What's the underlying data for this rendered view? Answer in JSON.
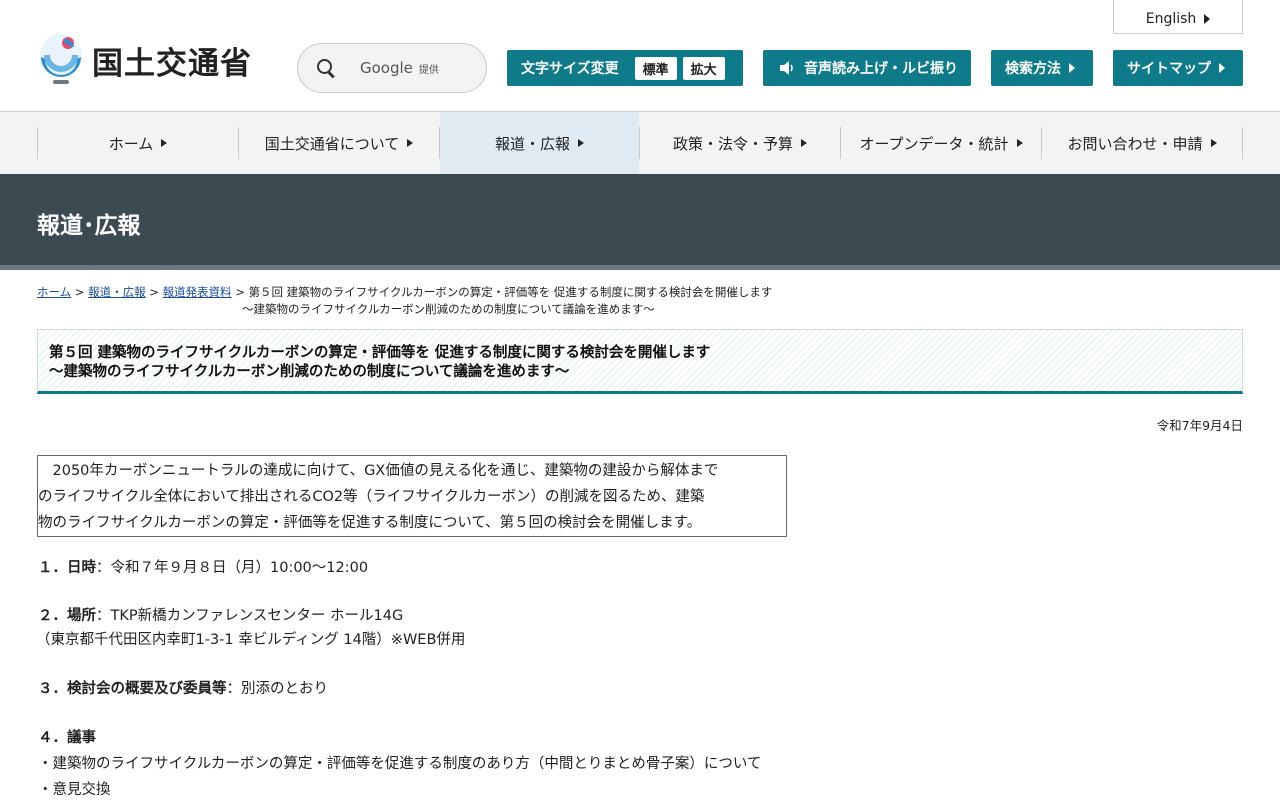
{
  "header": {
    "logo_text": "国土交通省",
    "search": {
      "label": "Google",
      "sub": "提供"
    },
    "english_label": "English",
    "font_size": {
      "label": "文字サイズ変更",
      "standard": "標準",
      "large": "拡大"
    },
    "voice_label": "音声読み上げ・ルビ振り",
    "search_method_label": "検索方法",
    "sitemap_label": "サイトマップ"
  },
  "nav": {
    "items": [
      {
        "label": "ホーム"
      },
      {
        "label": "国土交通省について"
      },
      {
        "label": "報道・広報"
      },
      {
        "label": "政策・法令・予算"
      },
      {
        "label": "オープンデータ・統計"
      },
      {
        "label": "お問い合わせ・申請"
      }
    ]
  },
  "banner": {
    "title": "報道･広報"
  },
  "breadcrumb": {
    "home": "ホーム",
    "press": "報道・広報",
    "releases": "報道発表資料",
    "sep": " > ",
    "current_line1": "第５回 建築物のライフサイクルカーボンの算定・評価等を 促進する制度に関する検討会を開催します",
    "current_line2": "～建築物のライフサイクルカーボン削減のための制度について議論を進めます～"
  },
  "article": {
    "title_line1": "第５回 建築物のライフサイクルカーボンの算定・評価等を 促進する制度に関する検討会を開催します",
    "title_line2": "～建築物のライフサイクルカーボン削減のための制度について議論を進めます～",
    "date": "令和7年9月4日",
    "intro_line1": "　2050年カーボンニュートラルの達成に向けて、GX価値の見える化を通じ、建築物の建設から解体まで",
    "intro_line2": "のライフサイクル全体において排出されるCO2等（ライフサイクルカーボン）の削減を図るため、建築",
    "intro_line3": "物のライフサイクルカーボンの算定・評価等を促進する制度について、第５回の検討会を開催します。",
    "s1_label": "１．日時",
    "s1_value": "：令和７年９月８日（月）10:00～12:00",
    "s2_label": "２．場所",
    "s2_value": "：TKP新橋カンファレンスセンター ホール14G",
    "s2_line2": "（東京都千代田区内幸町1-3-1 幸ビルディング 14階）※WEB併用",
    "s3_label": "３．検討会の概要及び委員等",
    "s3_value": "：別添のとおり",
    "s4_label": "４．議事",
    "s4_item1": "・建築物のライフサイクルカーボンの算定・評価等を促進する制度のあり方（中間とりまとめ骨子案）について",
    "s4_item2": "・意見交換"
  }
}
